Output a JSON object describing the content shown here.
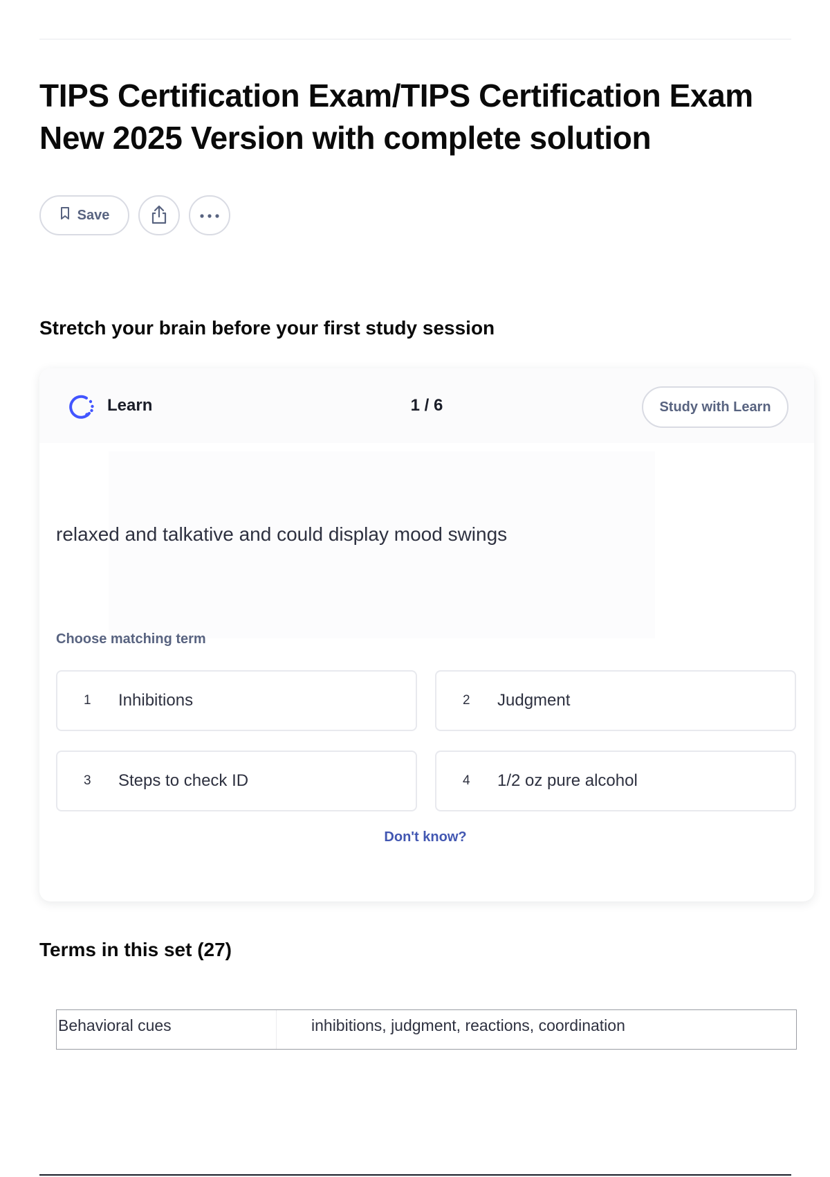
{
  "page": {
    "title": "TIPS Certification Exam/TIPS Certification Exam New 2025 Version with complete solution"
  },
  "actions": {
    "save_label": "Save",
    "save_icon": "bookmark-icon",
    "share_icon": "share-icon",
    "more_icon": "more-options-icon"
  },
  "stretch": {
    "heading": "Stretch your brain before your first study session"
  },
  "learn": {
    "label": "Learn",
    "progress": "1 / 6",
    "study_button": "Study with Learn",
    "accent_color": "#4255ff",
    "prompt": "relaxed and talkative and could display mood swings",
    "choose_label": "Choose matching term",
    "options": [
      {
        "number": "1",
        "text": "Inhibitions"
      },
      {
        "number": "2",
        "text": "Judgment"
      },
      {
        "number": "3",
        "text": "Steps to check ID"
      },
      {
        "number": "4",
        "text": "1/2 oz pure alcohol"
      }
    ],
    "dont_know": "Don't know?"
  },
  "terms": {
    "heading": "Terms in this set (27)",
    "rows": [
      {
        "term": "Behavioral cues",
        "definition": "inhibitions, judgment, reactions, coordination"
      }
    ]
  }
}
